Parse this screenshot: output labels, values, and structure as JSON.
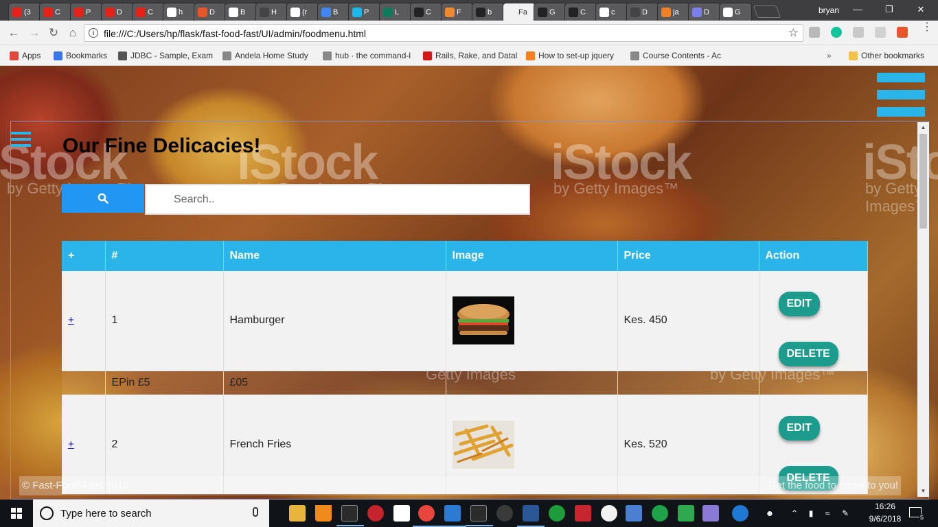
{
  "browser": {
    "tabs": [
      {
        "label": "(3",
        "icon": "youtube-icon",
        "color": "#e62117"
      },
      {
        "label": "C",
        "icon": "youtube-icon",
        "color": "#e62117"
      },
      {
        "label": "P",
        "icon": "youtube-icon",
        "color": "#e62117"
      },
      {
        "label": "D",
        "icon": "youtube-icon",
        "color": "#e62117"
      },
      {
        "label": "C",
        "icon": "youtube-icon",
        "color": "#e62117"
      },
      {
        "label": "h",
        "icon": "google-icon",
        "color": "#ffffff"
      },
      {
        "label": "D",
        "icon": "shield-icon",
        "color": "#e8552a"
      },
      {
        "label": "B",
        "icon": "medium-icon",
        "color": "#ffffff"
      },
      {
        "label": "H",
        "icon": "page-icon",
        "color": "#444444"
      },
      {
        "label": "(r",
        "icon": "gmail-icon",
        "color": "#ffffff"
      },
      {
        "label": "B",
        "icon": "docs-icon",
        "color": "#4285f4"
      },
      {
        "label": "P",
        "icon": "vimeo-icon",
        "color": "#1ab7ea"
      },
      {
        "label": "L",
        "icon": "pivotal-icon",
        "color": "#0e7a5c"
      },
      {
        "label": "C",
        "icon": "github-icon",
        "color": "#222222"
      },
      {
        "label": "F",
        "icon": "atom-icon",
        "color": "#f08a2c"
      },
      {
        "label": "b",
        "icon": "github-icon",
        "color": "#222222"
      },
      {
        "label": "Fa",
        "icon": "page-icon",
        "color": "#f2f2f2",
        "active": true
      },
      {
        "label": "G",
        "icon": "github-icon",
        "color": "#222222"
      },
      {
        "label": "C",
        "icon": "github-icon",
        "color": "#222222"
      },
      {
        "label": "c",
        "icon": "google-icon",
        "color": "#ffffff"
      },
      {
        "label": "D",
        "icon": "page-icon",
        "color": "#444444"
      },
      {
        "label": "ja",
        "icon": "stackoverflow-icon",
        "color": "#f48024"
      },
      {
        "label": "D",
        "icon": "circle-icon",
        "color": "#7b7fe6"
      },
      {
        "label": "G",
        "icon": "box-icon",
        "color": "#ffffff"
      }
    ],
    "user": "bryan",
    "url": "file:///C:/Users/hp/flask/fast-food-fast/UI/admin/foodmenu.html",
    "bookmarks": [
      {
        "label": "Apps",
        "icon": "apps-icon",
        "color": "#e04a3a"
      },
      {
        "label": "Bookmarks",
        "icon": "star-icon",
        "color": "#3b78e7"
      },
      {
        "label": "JDBC - Sample, Exam",
        "icon": "globe-icon",
        "color": "#555555"
      },
      {
        "label": "Andela Home Study",
        "icon": "page-icon",
        "color": "#888888"
      },
      {
        "label": "hub · the command-l",
        "icon": "page-icon",
        "color": "#888888"
      },
      {
        "label": "Rails, Rake, and Datal",
        "icon": "star-icon",
        "color": "#d11b1b"
      },
      {
        "label": "How to set-up jquery",
        "icon": "stackoverflow-icon",
        "color": "#f48024"
      },
      {
        "label": "Course Contents - Ac",
        "icon": "page-icon",
        "color": "#888888"
      }
    ],
    "more_bookmarks": "»",
    "other_bookmarks": "Other bookmarks"
  },
  "page": {
    "title": "Our Fine Delicacies!",
    "search": {
      "placeholder": "Search..",
      "value": ""
    },
    "table": {
      "headers": [
        "+",
        "#",
        "Name",
        "Image",
        "Price",
        "Action"
      ],
      "rows": [
        {
          "expand": "+",
          "num": "1",
          "name": "Hamburger",
          "image": "hamburger",
          "price": "Kes. 450",
          "edit": "EDIT",
          "delete": "DELETE"
        },
        {
          "expand": "+",
          "num": "2",
          "name": "French Fries",
          "image": "french-fries",
          "price": "Kes. 520",
          "edit": "EDIT",
          "delete": "DELETE"
        }
      ],
      "detail_row": {
        "a": "EPin £5",
        "b": "£05"
      }
    },
    "footer": {
      "left": "© Fast-Food-Fast 2018",
      "right": "Get the food to come to you!"
    },
    "watermark": {
      "brand": "iStock",
      "sub": "by Getty Images™",
      "sub2": "Getty Images"
    },
    "accent": "#2ab4e8",
    "button_color": "#1d9b8c"
  },
  "taskbar": {
    "search_placeholder": "Type here to search",
    "time": "16:26",
    "date": "9/6/2018",
    "notification_count": "5"
  }
}
